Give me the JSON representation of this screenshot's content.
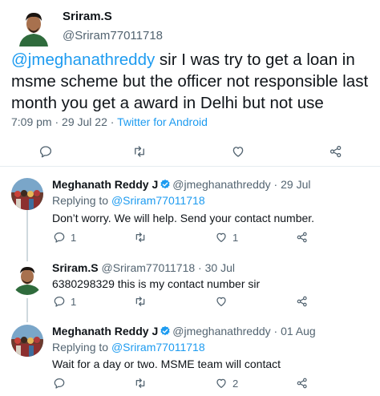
{
  "main_tweet": {
    "name": "Sriram.S",
    "handle": "@Sriram77011718",
    "mention": "@jmeghanathreddy",
    "text_after_mention": " sir I was try to get a loan in msme scheme but the officer not responsible last month you get a award in Delhi but not use",
    "time": "7:09 pm",
    "date": "29 Jul 22",
    "source": "Twitter for Android"
  },
  "replies": [
    {
      "name": "Meghanath Reddy J",
      "verified": true,
      "handle": "@jmeghanathreddy",
      "date": "29 Jul",
      "replying_prefix": "Replying to ",
      "replying_handle": "@Sriram77011718",
      "text": "Don’t worry. We will help. Send your contact number.",
      "reply_count": "1",
      "like_count": "1"
    },
    {
      "name": "Sriram.S",
      "verified": false,
      "handle": "@Sriram77011718",
      "date": "30 Jul",
      "text": "6380298329 this is my contact number sir",
      "reply_count": "1",
      "like_count": ""
    },
    {
      "name": "Meghanath Reddy J",
      "verified": true,
      "handle": "@jmeghanathreddy",
      "date": "01 Aug",
      "replying_prefix": "Replying to ",
      "replying_handle": "@Sriram77011718",
      "text": "Wait for a day or two. MSME team will contact",
      "reply_count": "",
      "like_count": "2"
    }
  ],
  "separator": " · ",
  "icons": [
    "reply-icon",
    "retweet-icon",
    "like-icon",
    "share-icon",
    "verified-badge-icon"
  ],
  "colors": {
    "link": "#1d9bf0",
    "muted": "#536471",
    "text": "#0f1419"
  }
}
